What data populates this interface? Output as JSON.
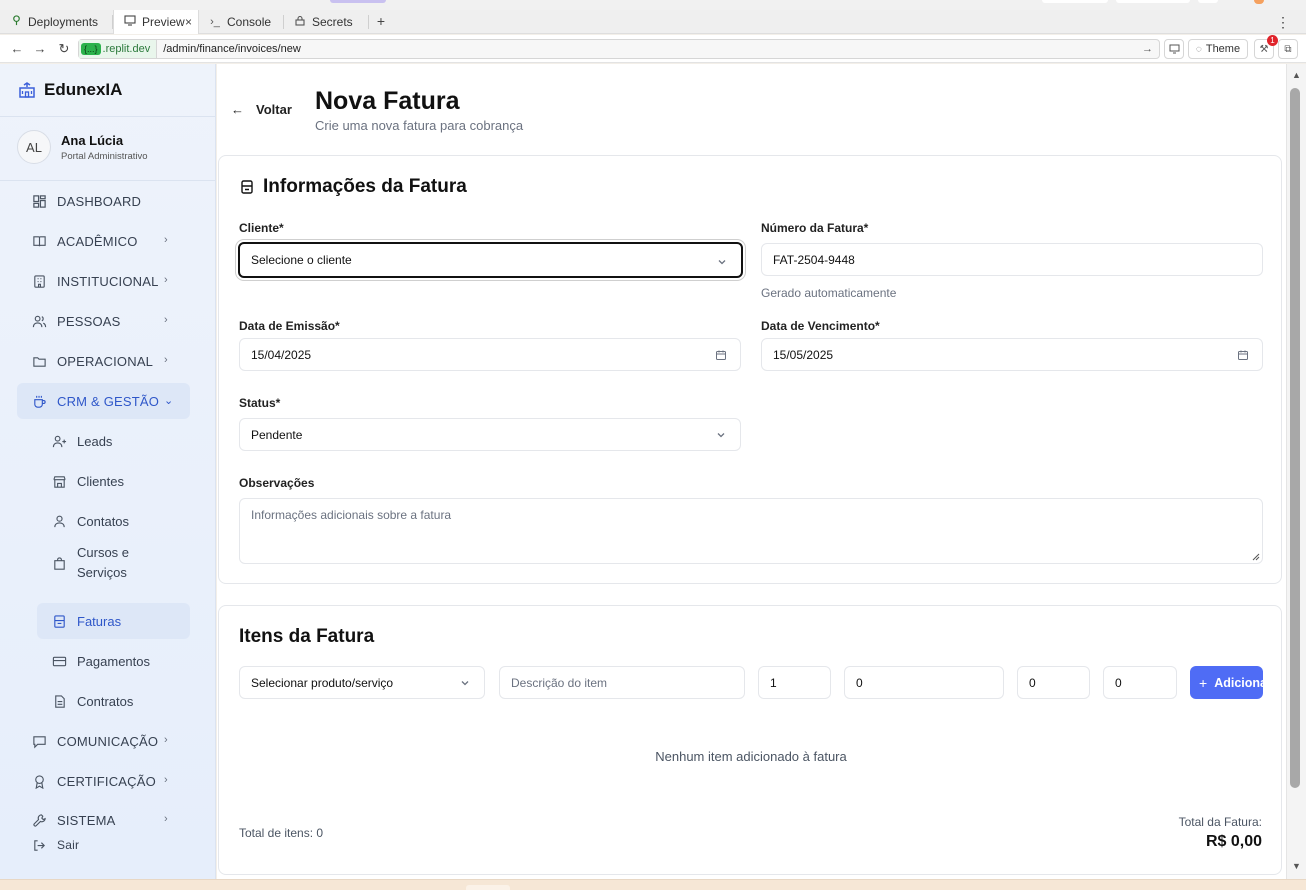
{
  "browser": {
    "tabs": [
      {
        "label": "Deployments",
        "icon": "deployments-icon"
      },
      {
        "label": "Preview",
        "icon": "monitor-icon",
        "active": true
      },
      {
        "label": "Console",
        "icon": "terminal-icon"
      },
      {
        "label": "Secrets",
        "icon": "lock-icon"
      }
    ],
    "url_host": ".replit.dev",
    "url_badge": "{...}",
    "url_path": "/admin/finance/invoices/new",
    "theme_label": "Theme",
    "notification_count": "1"
  },
  "sidebar": {
    "brand": "EdunexIA",
    "user": {
      "initials": "AL",
      "name": "Ana Lúcia",
      "role": "Portal Administrativo"
    },
    "items": [
      {
        "label": "DASHBOARD",
        "icon": "dashboard-icon"
      },
      {
        "label": "ACADÊMICO",
        "icon": "book-open-icon"
      },
      {
        "label": "INSTITUCIONAL",
        "icon": "building-icon"
      },
      {
        "label": "PESSOAS",
        "icon": "users-icon"
      },
      {
        "label": "OPERACIONAL",
        "icon": "folder-icon"
      },
      {
        "label": "CRM & GESTÃO",
        "icon": "coffee-icon",
        "active": true,
        "expanded": true
      }
    ],
    "sub_items": [
      {
        "label": "Leads",
        "icon": "user-plus-icon"
      },
      {
        "label": "Clientes",
        "icon": "store-icon"
      },
      {
        "label": "Contatos",
        "icon": "user-icon"
      },
      {
        "label": "Cursos e Serviços",
        "line1": "Cursos e",
        "line2": "Serviços",
        "icon": "shopping-bag-icon"
      },
      {
        "label": "Faturas",
        "icon": "receipt-icon",
        "active": true
      },
      {
        "label": "Pagamentos",
        "icon": "credit-card-icon"
      },
      {
        "label": "Contratos",
        "icon": "file-text-icon"
      }
    ],
    "lower_items": [
      {
        "label": "COMUNICAÇÃO",
        "icon": "message-square-icon"
      },
      {
        "label": "CERTIFICAÇÃO",
        "icon": "award-icon"
      },
      {
        "label": "SISTEMA",
        "icon": "wrench-icon"
      }
    ],
    "logout": "Sair"
  },
  "header": {
    "back_label": "Voltar",
    "title": "Nova Fatura",
    "subtitle": "Crie uma nova fatura para cobrança"
  },
  "invoice_info": {
    "title": "Informações da Fatura",
    "client_label": "Cliente*",
    "client_value": "Selecione o cliente",
    "number_label": "Número da Fatura*",
    "number_value": "FAT-2504-9448",
    "number_hint": "Gerado automaticamente",
    "issue_label": "Data de Emissão*",
    "issue_value": "15/04/2025",
    "due_label": "Data de Vencimento*",
    "due_value": "15/05/2025",
    "status_label": "Status*",
    "status_value": "Pendente",
    "notes_label": "Observações",
    "notes_placeholder": "Informações adicionais sobre a fatura"
  },
  "items": {
    "title": "Itens da Fatura",
    "product_select": "Selecionar produto/serviço",
    "description_placeholder": "Descrição do item",
    "quantity": "1",
    "unit_price": "0",
    "discount": "0",
    "tax": "0",
    "add_label": "Adicionar",
    "empty_message": "Nenhum item adicionado à fatura",
    "total_items": "Total de itens: 0",
    "total_label": "Total da Fatura:",
    "total_value": "R$ 0,00"
  },
  "colors": {
    "accent": "#4f6cf5",
    "active_nav": "#2f57c9"
  }
}
